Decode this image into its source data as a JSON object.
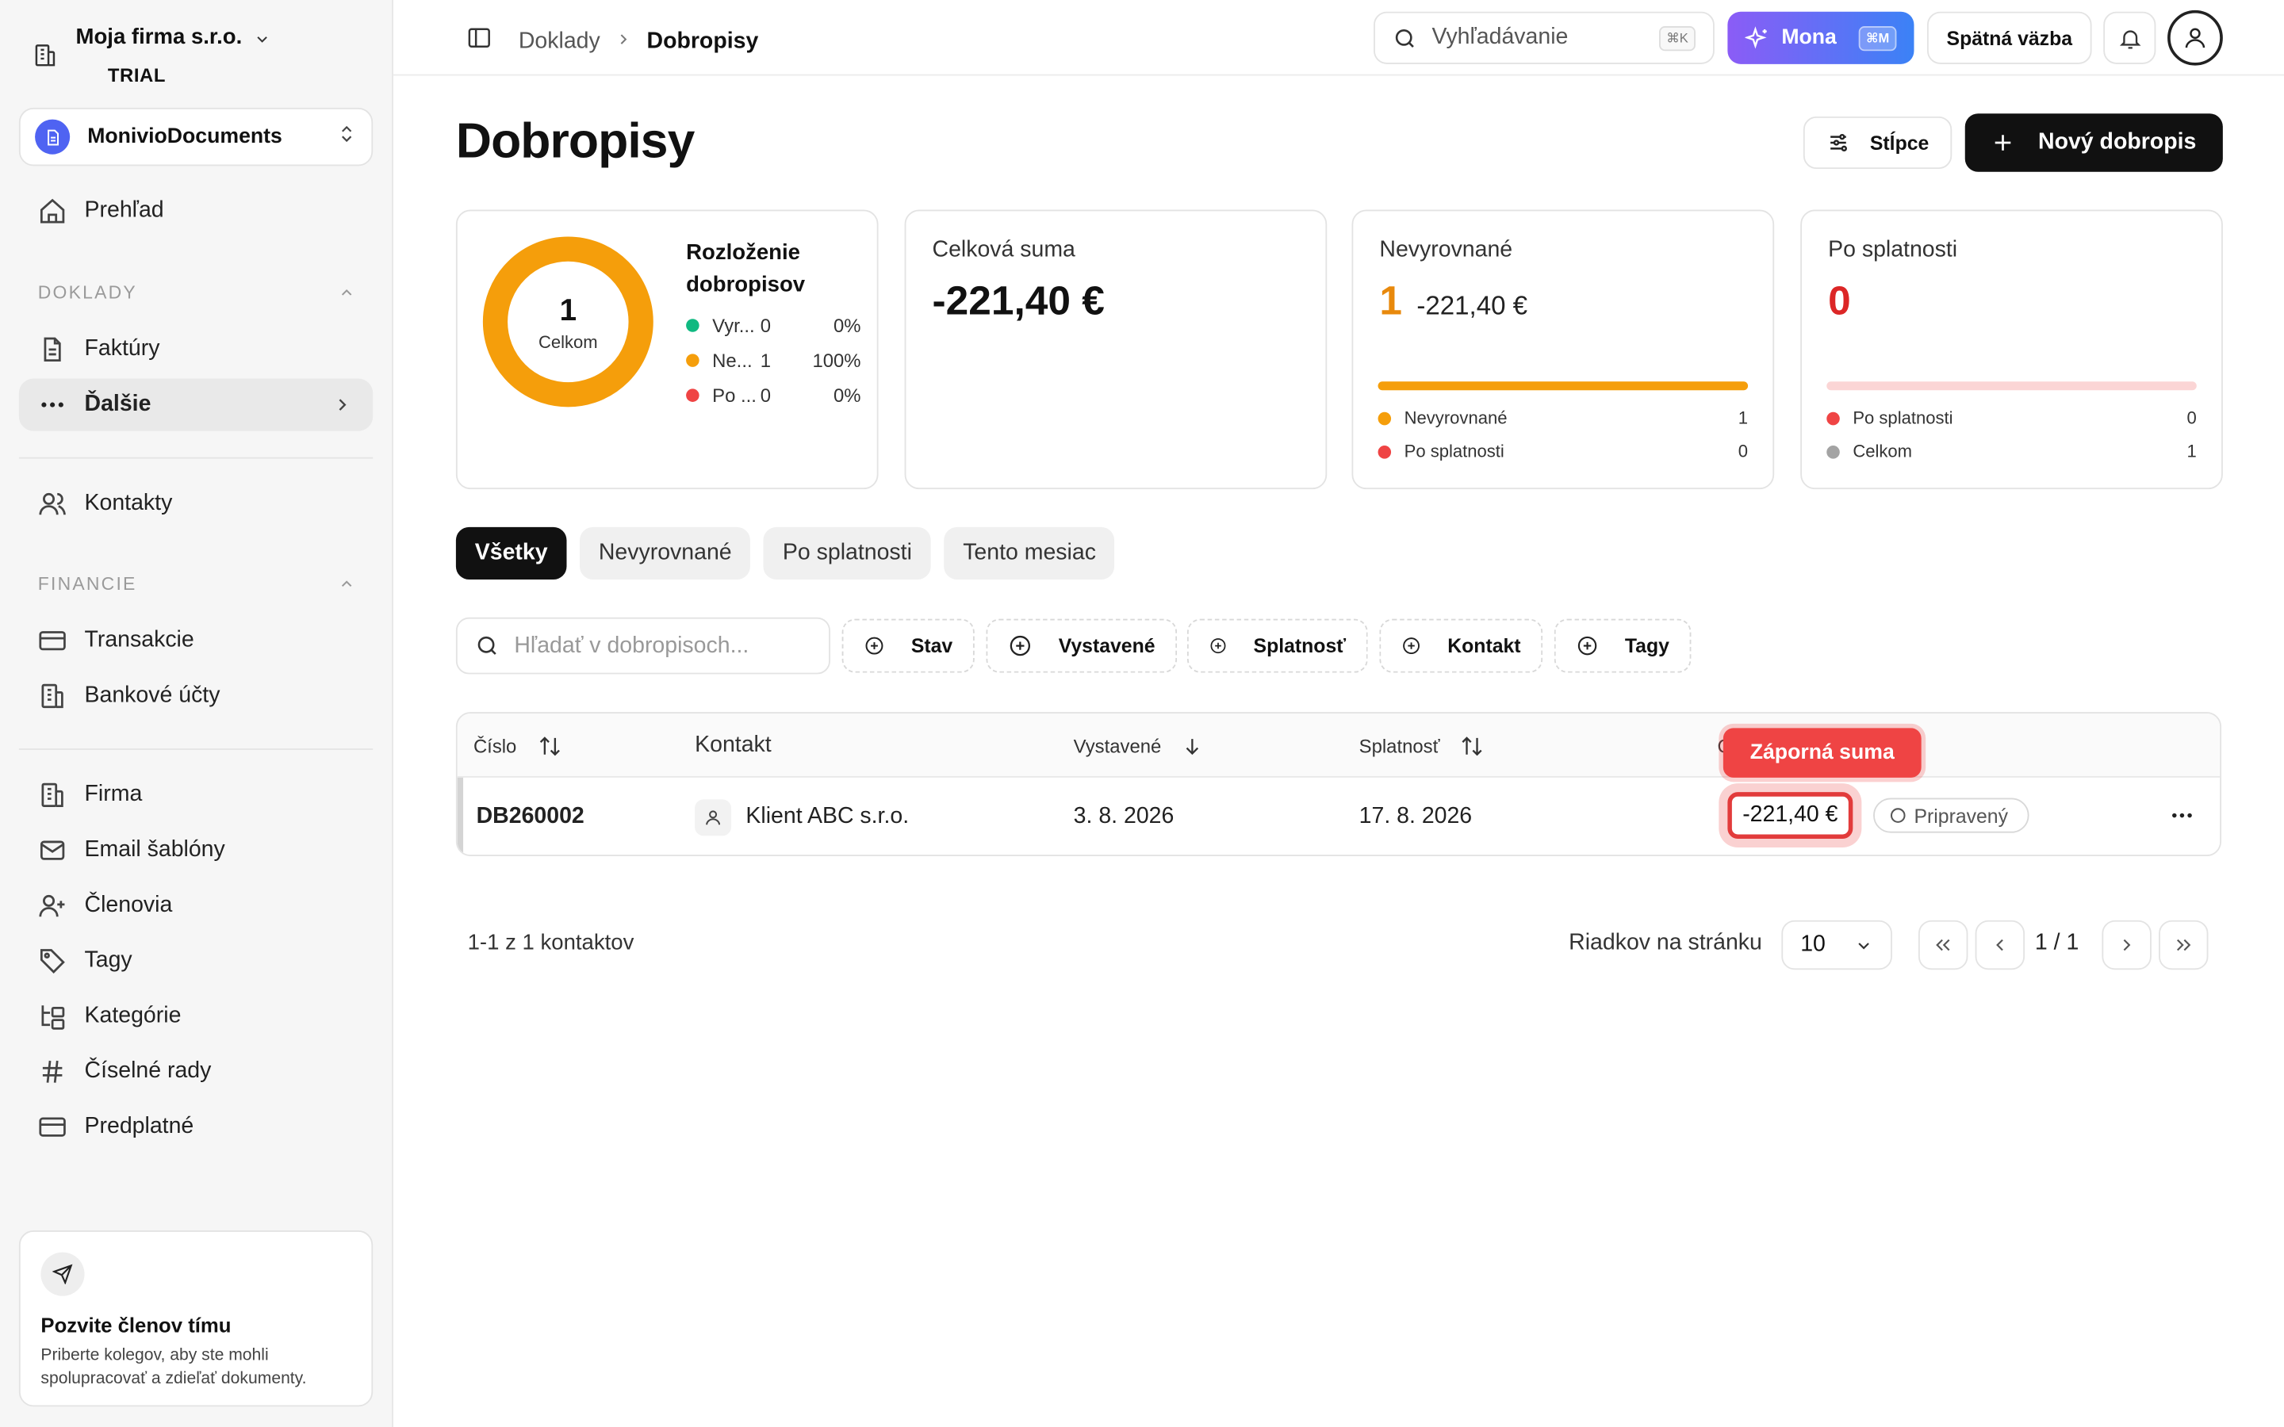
{
  "sidebar": {
    "company_name": "Moja firma s.r.o.",
    "company_badge": "TRIAL",
    "app_selector": "MonivioDocuments",
    "overview": "Prehľad",
    "section_doklady": "DOKLADY",
    "invoices": "Faktúry",
    "more": "Ďalšie",
    "contacts": "Kontakty",
    "section_finance": "FINANCIE",
    "transactions": "Transakcie",
    "bank_accounts": "Bankové účty",
    "company": "Firma",
    "email_templates": "Email šablóny",
    "members": "Členovia",
    "tags": "Tagy",
    "categories": "Kategórie",
    "number_series": "Číselné rady",
    "subscription": "Predplatné",
    "invite": {
      "title": "Pozvite členov tímu",
      "text": "Priberte kolegov, aby ste mohli spolupracovať a zdieľať dokumenty."
    }
  },
  "topbar": {
    "breadcrumb_parent": "Doklady",
    "breadcrumb_current": "Dobropisy",
    "search_label": "Vyhľadávanie",
    "search_shortcut": "⌘K",
    "mona_label": "Mona",
    "mona_shortcut": "⌘M",
    "feedback": "Spätná väzba"
  },
  "page": {
    "title": "Dobropisy",
    "columns_button": "Stĺpce",
    "new_button": "Nový dobropis"
  },
  "cards": {
    "distribution": {
      "title_line1": "Rozloženie",
      "title_line2": "dobropisov",
      "total": "1",
      "total_label": "Celkom",
      "rows": [
        {
          "name": "Vyr...",
          "count": "0",
          "percent": "0%",
          "color": "#10b981"
        },
        {
          "name": "Ne...",
          "count": "1",
          "percent": "100%",
          "color": "#f59e0b"
        },
        {
          "name": "Po ...",
          "count": "0",
          "percent": "0%",
          "color": "#ef4444"
        }
      ]
    },
    "total_sum": {
      "label": "Celková suma",
      "value": "-221,40 €"
    },
    "unpaid": {
      "label": "Nevyrovnané",
      "count": "1",
      "amount": "-221,40 €",
      "bar_fraction": 1.0,
      "legend": [
        {
          "label": "Nevyrovnané",
          "value": "1",
          "color": "#f59e0b"
        },
        {
          "label": "Po splatnosti",
          "value": "0",
          "color": "#ef4444"
        }
      ]
    },
    "overdue": {
      "label": "Po splatnosti",
      "count": "0",
      "bar_fraction": 0.0,
      "legend": [
        {
          "label": "Po splatnosti",
          "value": "0",
          "color": "#ef4444"
        },
        {
          "label": "Celkom",
          "value": "1",
          "color": "#a3a3a3"
        }
      ]
    }
  },
  "tabs": [
    "Všetky",
    "Nevyrovnané",
    "Po splatnosti",
    "Tento mesiac"
  ],
  "filters": {
    "search_placeholder": "Hľadať v dobropisoch...",
    "chips": [
      "Stav",
      "Vystavené",
      "Splatnosť",
      "Kontakt",
      "Tagy"
    ]
  },
  "table": {
    "headers": {
      "number": "Číslo",
      "contact": "Kontakt",
      "issued": "Vystavené",
      "due": "Splatnosť",
      "amount_partial": "C"
    },
    "rows": [
      {
        "number": "DB260002",
        "contact": "Klient ABC s.r.o.",
        "issued": "3. 8. 2026",
        "due": "17. 8. 2026",
        "amount": "-221,40 €",
        "status": "Pripravený"
      }
    ],
    "tooltip": "Záporná suma"
  },
  "pagination": {
    "summary": "1-1 z 1 kontaktov",
    "rows_label": "Riadkov na stránku",
    "rows_value": "10",
    "page": "1 / 1"
  },
  "colors": {
    "accent_orange": "#f59e0b",
    "danger": "#ef4444",
    "success": "#10b981"
  }
}
